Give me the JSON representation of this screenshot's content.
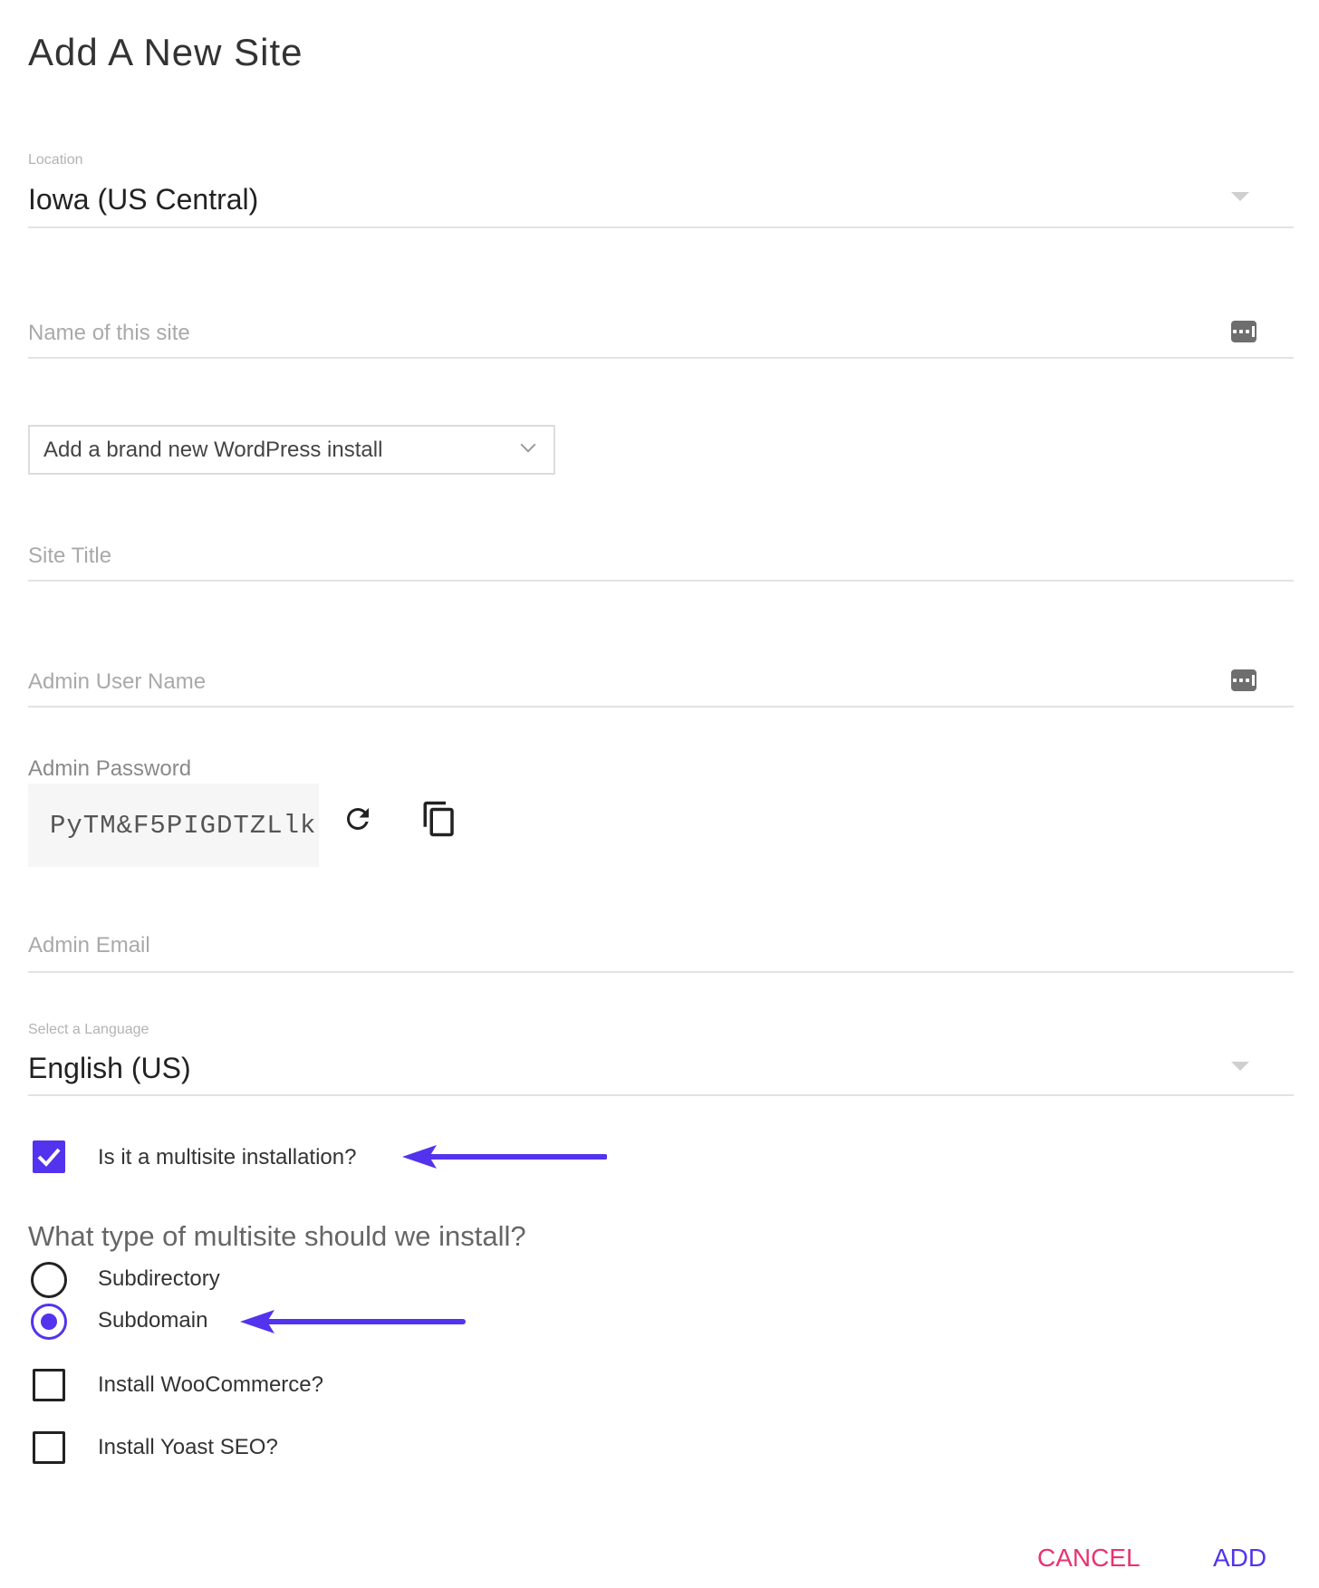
{
  "dialog": {
    "title": "Add A New Site"
  },
  "location": {
    "label": "Location",
    "value": "Iowa (US Central)"
  },
  "site_name": {
    "placeholder": "Name of this site",
    "icon": "more-dots-icon"
  },
  "install_type": {
    "value": "Add a brand new WordPress install"
  },
  "site_title": {
    "placeholder": "Site Title"
  },
  "admin_user": {
    "placeholder": "Admin User Name",
    "icon": "more-dots-icon"
  },
  "admin_password": {
    "label": "Admin Password",
    "value": "PyTM&F5PIGDTZLlk",
    "regenerate_icon": "refresh-icon",
    "copy_icon": "copy-icon"
  },
  "admin_email": {
    "placeholder": "Admin Email"
  },
  "language": {
    "label": "Select a Language",
    "value": "English (US)"
  },
  "multisite": {
    "checkbox_label": "Is it a multisite installation?",
    "checked": true,
    "question": "What type of multisite should we install?",
    "options": [
      {
        "label": "Subdirectory",
        "selected": false
      },
      {
        "label": "Subdomain",
        "selected": true
      }
    ]
  },
  "extras": [
    {
      "label": "Install WooCommerce?",
      "checked": false
    },
    {
      "label": "Install Yoast SEO?",
      "checked": false
    }
  ],
  "actions": {
    "cancel_label": "CANCEL",
    "add_label": "ADD"
  },
  "colors": {
    "accent": "#5333ed",
    "cancel": "#e8336f",
    "add": "#5333ed"
  }
}
